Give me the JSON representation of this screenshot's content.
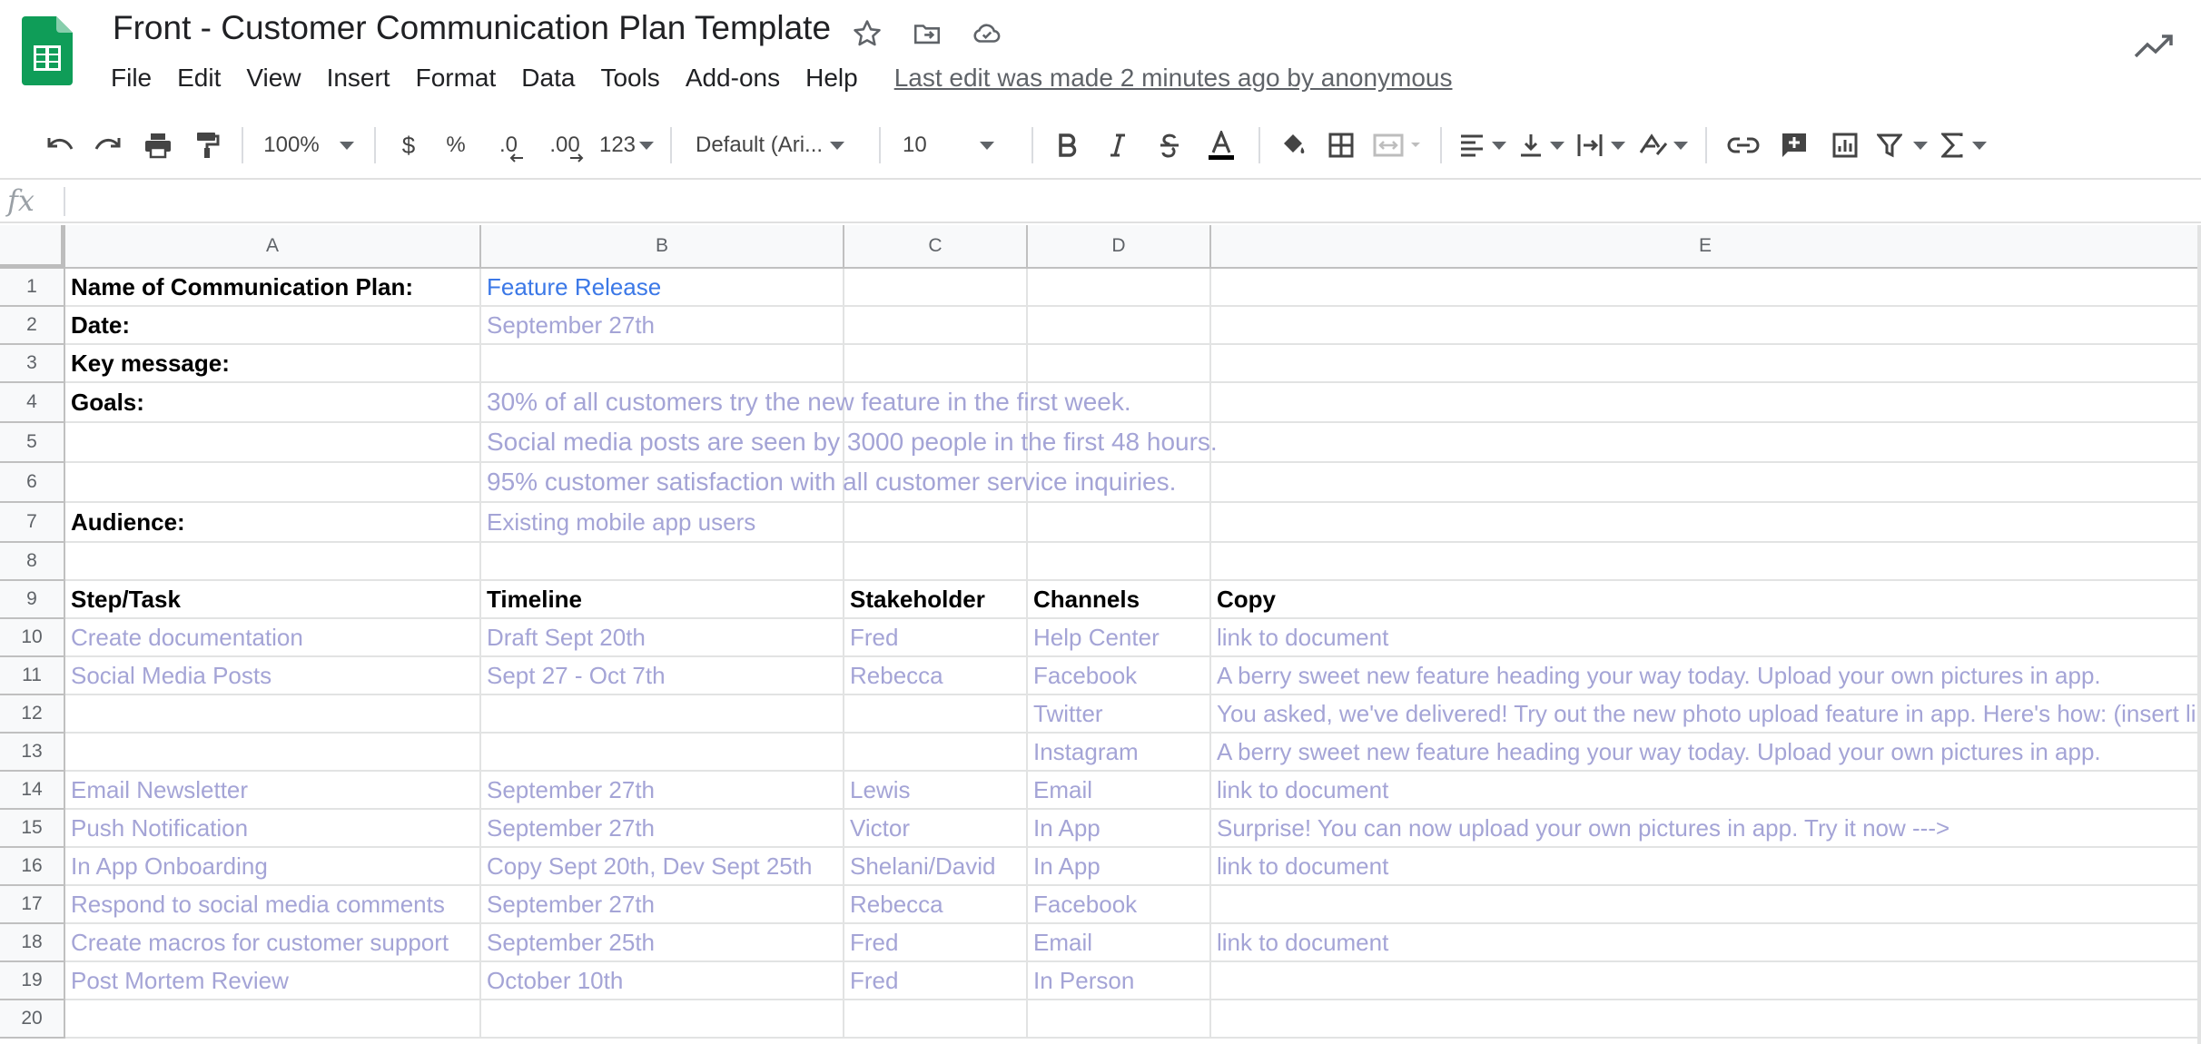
{
  "title": "Front - Customer Communication Plan Template",
  "menu": [
    "File",
    "Edit",
    "View",
    "Insert",
    "Format",
    "Data",
    "Tools",
    "Add-ons",
    "Help"
  ],
  "last_edit": "Last edit was made 2 minutes ago by anonymous",
  "toolbar": {
    "zoom": "100%",
    "currency": "$",
    "percent": "%",
    "dec_decrease": ".0",
    "dec_increase": ".00",
    "more_formats": "123",
    "font": "Default (Ari...",
    "font_size": "10"
  },
  "formula_bar": {
    "fx": "fx"
  },
  "columns": [
    "A",
    "B",
    "C",
    "D",
    "E"
  ],
  "rows": [
    "1",
    "2",
    "3",
    "4",
    "5",
    "6",
    "7",
    "8",
    "9",
    "10",
    "11",
    "12",
    "13",
    "14",
    "15",
    "16",
    "17",
    "18",
    "19",
    "20"
  ],
  "cells": {
    "A1": "Name of Communication Plan:",
    "B1": "Feature Release",
    "A2": "Date:",
    "B2": "September 27th",
    "A3": "Key message:",
    "A4": "Goals:",
    "B4": "30% of all customers try the new feature in the first week.",
    "B5": "Social media posts are seen by 3000 people in the first 48 hours.",
    "B6": "95% customer satisfaction with all customer service inquiries.",
    "A7": "Audience:",
    "B7": "Existing mobile app users",
    "A9": "Step/Task",
    "B9": "Timeline",
    "C9": "Stakeholder",
    "D9": "Channels",
    "E9": "Copy",
    "A10": "Create documentation",
    "B10": "Draft Sept 20th",
    "C10": "Fred",
    "D10": "Help Center",
    "E10": "link to document",
    "A11": "Social Media Posts",
    "B11": "Sept 27 - Oct 7th",
    "C11": "Rebecca",
    "D11": "Facebook",
    "E11": "A berry sweet new feature heading your way today. Upload your own pictures in app.",
    "D12": "Twitter",
    "E12": "You asked, we've delivered! Try out the new photo upload feature in app. Here's how: (insert li",
    "D13": "Instagram",
    "E13": "A berry sweet new feature heading your way today. Upload your own pictures in app.",
    "A14": "Email Newsletter",
    "B14": "September 27th",
    "C14": "Lewis",
    "D14": "Email",
    "E14": "link to document",
    "A15": "Push Notification",
    "B15": "September 27th",
    "C15": "Victor",
    "D15": "In App",
    "E15": "Surprise! You can now upload your own pictures in app. Try it now --->",
    "A16": "In App Onboarding",
    "B16": "Copy Sept 20th, Dev Sept 25th",
    "C16": "Shelani/David",
    "D16": "In App",
    "E16": "link to document",
    "A17": "Respond to social media comments",
    "B17": "September 27th",
    "C17": "Rebecca",
    "D17": "Facebook",
    "A18": "Create macros for customer support",
    "B18": "September 25th",
    "C18": "Fred",
    "D18": "Email",
    "E18": "link to document",
    "A19": "Post Mortem Review",
    "B19": "October 10th",
    "C19": "Fred",
    "D19": "In Person"
  },
  "colors": {
    "accent_green": "#0f9d58",
    "link": "#3b78e7",
    "muted_text": "#a4a4d6"
  }
}
